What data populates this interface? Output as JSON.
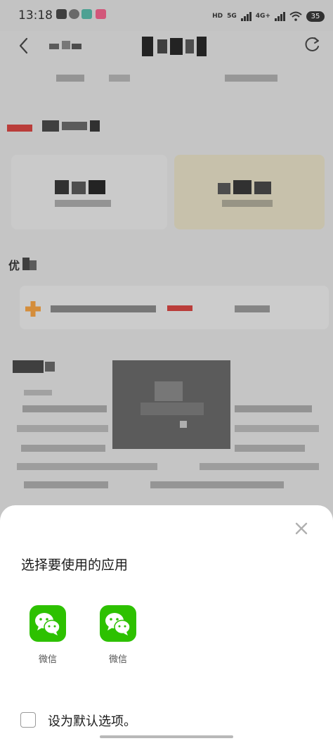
{
  "status_bar": {
    "time": "13:18",
    "hd_label": "HD",
    "network_1": "5G",
    "network_2": "4G+",
    "battery": "35"
  },
  "background": {
    "section_heading": "优"
  },
  "chooser": {
    "title": "选择要使用的应用",
    "apps": [
      {
        "label": "微信",
        "icon": "wechat-icon"
      },
      {
        "label": "微信",
        "icon": "wechat-icon"
      }
    ],
    "default_option_label": "设为默认选项。",
    "default_checked": false
  },
  "colors": {
    "wechat_green": "#2dc100",
    "sheet_bg": "#ffffff",
    "accent_orange": "#e8922e",
    "accent_red": "#c9302c"
  }
}
